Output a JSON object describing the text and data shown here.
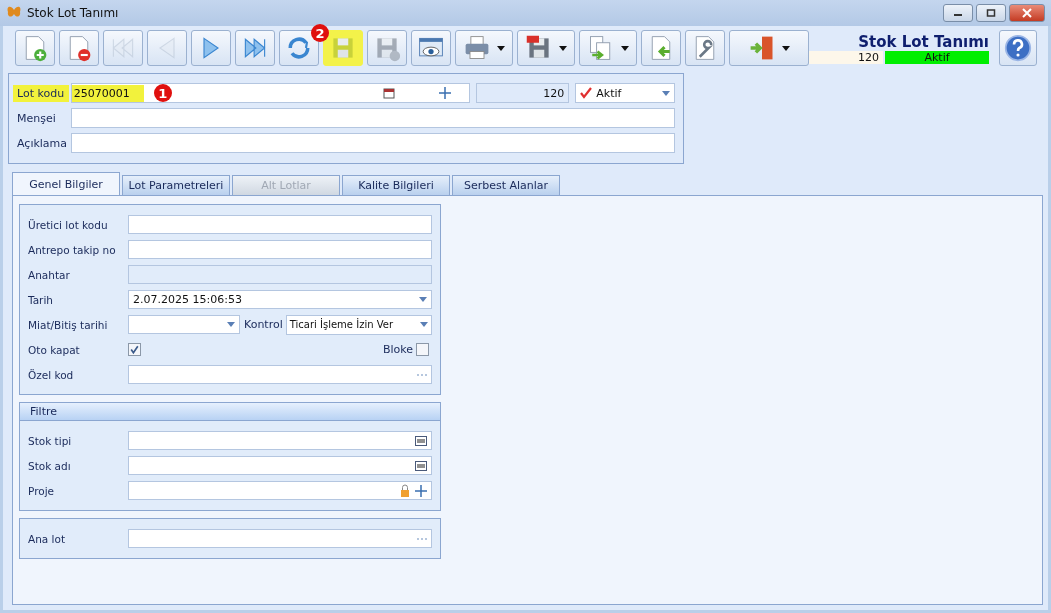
{
  "window": {
    "title": "Stok Lot Tanımı"
  },
  "toolbar": [
    {
      "kind": "new",
      "disabled": false,
      "highlighted": false,
      "dropdown": false
    },
    {
      "kind": "delete",
      "disabled": false,
      "highlighted": false,
      "dropdown": false
    },
    {
      "kind": "first",
      "disabled": true,
      "highlighted": false,
      "dropdown": false
    },
    {
      "kind": "prev",
      "disabled": true,
      "highlighted": false,
      "dropdown": false
    },
    {
      "kind": "next",
      "disabled": false,
      "highlighted": false,
      "dropdown": false
    },
    {
      "kind": "last",
      "disabled": false,
      "highlighted": false,
      "dropdown": false
    },
    {
      "kind": "refresh",
      "disabled": false,
      "highlighted": false,
      "dropdown": false,
      "badge": "2"
    },
    {
      "kind": "save",
      "disabled": false,
      "highlighted": true,
      "dropdown": false
    },
    {
      "kind": "cancel",
      "disabled": true,
      "highlighted": false,
      "dropdown": false
    },
    {
      "kind": "preview",
      "disabled": false,
      "highlighted": false,
      "dropdown": false
    },
    {
      "kind": "print",
      "disabled": false,
      "highlighted": false,
      "dropdown": true
    },
    {
      "kind": "pdf",
      "disabled": false,
      "highlighted": false,
      "dropdown": true
    },
    {
      "kind": "export",
      "disabled": false,
      "highlighted": false,
      "dropdown": true
    },
    {
      "kind": "import",
      "disabled": false,
      "highlighted": false,
      "dropdown": false
    },
    {
      "kind": "tools",
      "disabled": false,
      "highlighted": false,
      "dropdown": false
    },
    {
      "kind": "exit",
      "disabled": false,
      "highlighted": false,
      "dropdown": true
    }
  ],
  "header": {
    "title": "Stok Lot Tanımı",
    "code": "120",
    "status": "Aktif"
  },
  "lot": {
    "label": "Lot kodu",
    "value": "25070001",
    "highlighted": true,
    "badge": "1",
    "number": "120",
    "status": "Aktif"
  },
  "fields": [
    {
      "label": "Menşei"
    },
    {
      "label": "Açıklama"
    }
  ],
  "tabs": [
    {
      "label": "Genel Bilgiler",
      "selected": true,
      "disabled": false
    },
    {
      "label": "Lot Parametreleri",
      "selected": false,
      "disabled": false
    },
    {
      "label": "Alt Lotlar",
      "selected": false,
      "disabled": true
    },
    {
      "label": "Kalite Bilgileri",
      "selected": false,
      "disabled": false
    },
    {
      "label": "Serbest Alanlar",
      "selected": false,
      "disabled": false
    }
  ],
  "groups": [
    {
      "rows": [
        {
          "kind": "text",
          "label": "Üretici lot kodu"
        },
        {
          "kind": "text",
          "label": "Antrepo takip no"
        },
        {
          "kind": "readonly",
          "label": "Anahtar"
        },
        {
          "kind": "date",
          "label": "Tarih",
          "value": "2.07.2025 15:06:53"
        },
        {
          "kind": "pair",
          "label": "Miat/Bitiş tarihi",
          "label2": "Kontrol",
          "value2": "Ticari İşleme İzin Ver"
        },
        {
          "kind": "checks",
          "label": "Oto kapat",
          "checked": true,
          "label2": "Bloke",
          "checked2": false
        },
        {
          "kind": "ellipsis",
          "label": "Özel kod"
        }
      ]
    },
    {
      "title": "Filtre",
      "rows": [
        {
          "kind": "lookup",
          "label": "Stok tipi"
        },
        {
          "kind": "lookup",
          "label": "Stok adı"
        },
        {
          "kind": "project",
          "label": "Proje"
        }
      ]
    },
    {
      "rows": [
        {
          "kind": "ellipsis",
          "label": "Ana lot"
        }
      ]
    }
  ]
}
